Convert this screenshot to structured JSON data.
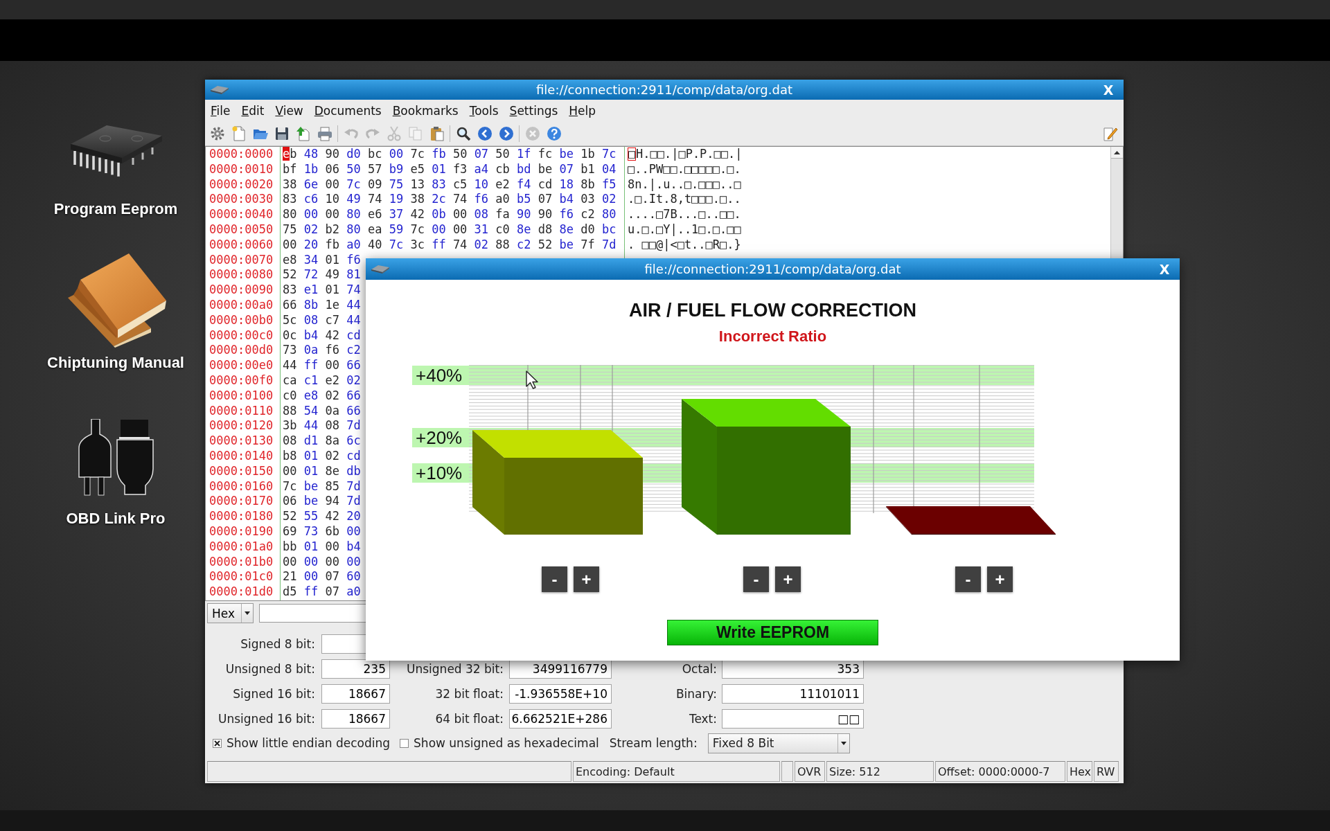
{
  "desktop_icons": [
    {
      "kind": "chip",
      "label": "Program Eeprom"
    },
    {
      "kind": "book",
      "label": "Chiptuning Manual"
    },
    {
      "kind": "plug",
      "label": "OBD Link Pro"
    }
  ],
  "editor_window": {
    "title": "file://connection:2911/comp/data/org.dat",
    "close": "X",
    "menu": [
      "File",
      "Edit",
      "View",
      "Documents",
      "Bookmarks",
      "Tools",
      "Settings",
      "Help"
    ],
    "toolbar_groups": [
      [
        {
          "kind": "settings",
          "disabled": false
        },
        {
          "kind": "new",
          "disabled": false
        },
        {
          "kind": "open",
          "disabled": false
        },
        {
          "kind": "save",
          "disabled": false
        },
        {
          "kind": "export",
          "disabled": false
        },
        {
          "kind": "print",
          "disabled": false
        }
      ],
      [
        {
          "kind": "undo",
          "disabled": true
        },
        {
          "kind": "redo",
          "disabled": true
        },
        {
          "kind": "cut",
          "disabled": true
        },
        {
          "kind": "copy",
          "disabled": true
        },
        {
          "kind": "paste",
          "disabled": false
        }
      ],
      [
        {
          "kind": "find",
          "disabled": false
        },
        {
          "kind": "back",
          "disabled": false
        },
        {
          "kind": "forward",
          "disabled": false
        }
      ],
      [
        {
          "kind": "stop",
          "disabled": true
        },
        {
          "kind": "help",
          "disabled": false
        }
      ]
    ],
    "toolbar_right": [
      {
        "kind": "edit",
        "disabled": false
      }
    ],
    "hex_view": {
      "rows": [
        {
          "address": "0000:0000",
          "bytes": [
            "eb",
            "48",
            "90",
            "d0",
            "bc",
            "00",
            "7c",
            "fb",
            "50",
            "07",
            "50",
            "1f",
            "fc",
            "be",
            "1b",
            "7c"
          ],
          "ascii": "□H.□□.|□P.P.□□.|",
          "cursor": true
        },
        {
          "address": "0000:0010",
          "bytes": [
            "bf",
            "1b",
            "06",
            "50",
            "57",
            "b9",
            "e5",
            "01",
            "f3",
            "a4",
            "cb",
            "bd",
            "be",
            "07",
            "b1",
            "04"
          ],
          "ascii": "□..PW□□.□□□□□.□.",
          "cursor": false
        },
        {
          "address": "0000:0020",
          "bytes": [
            "38",
            "6e",
            "00",
            "7c",
            "09",
            "75",
            "13",
            "83",
            "c5",
            "10",
            "e2",
            "f4",
            "cd",
            "18",
            "8b",
            "f5"
          ],
          "ascii": "8n.|.u..□.□□□..□",
          "cursor": false
        },
        {
          "address": "0000:0030",
          "bytes": [
            "83",
            "c6",
            "10",
            "49",
            "74",
            "19",
            "38",
            "2c",
            "74",
            "f6",
            "a0",
            "b5",
            "07",
            "b4",
            "03",
            "02"
          ],
          "ascii": ".□.It.8,t□□□.□..",
          "cursor": false
        },
        {
          "address": "0000:0040",
          "bytes": [
            "80",
            "00",
            "00",
            "80",
            "e6",
            "37",
            "42",
            "0b",
            "00",
            "08",
            "fa",
            "90",
            "90",
            "f6",
            "c2",
            "80"
          ],
          "ascii": "....□7B...□..□□.",
          "cursor": false
        },
        {
          "address": "0000:0050",
          "bytes": [
            "75",
            "02",
            "b2",
            "80",
            "ea",
            "59",
            "7c",
            "00",
            "00",
            "31",
            "c0",
            "8e",
            "d8",
            "8e",
            "d0",
            "bc"
          ],
          "ascii": "u.□.□Y|..1□.□.□□",
          "cursor": false
        },
        {
          "address": "0000:0060",
          "bytes": [
            "00",
            "20",
            "fb",
            "a0",
            "40",
            "7c",
            "3c",
            "ff",
            "74",
            "02",
            "88",
            "c2",
            "52",
            "be",
            "7f",
            "7d"
          ],
          "ascii": ". □□@|<□t..□R□.}",
          "cursor": false
        },
        {
          "address": "0000:0070",
          "bytes": [
            "e8",
            "34",
            "01",
            "f6"
          ],
          "cursor": false
        },
        {
          "address": "0000:0080",
          "bytes": [
            "52",
            "72",
            "49",
            "81"
          ],
          "cursor": false
        },
        {
          "address": "0000:0090",
          "bytes": [
            "83",
            "e1",
            "01",
            "74"
          ],
          "cursor": false
        },
        {
          "address": "0000:00a0",
          "bytes": [
            "66",
            "8b",
            "1e",
            "44"
          ],
          "cursor": false
        },
        {
          "address": "0000:00b0",
          "bytes": [
            "5c",
            "08",
            "c7",
            "44"
          ],
          "cursor": false
        },
        {
          "address": "0000:00c0",
          "bytes": [
            "0c",
            "b4",
            "42",
            "cd"
          ],
          "cursor": false
        },
        {
          "address": "0000:00d0",
          "bytes": [
            "73",
            "0a",
            "f6",
            "c2"
          ],
          "cursor": false
        },
        {
          "address": "0000:00e0",
          "bytes": [
            "44",
            "ff",
            "00",
            "66"
          ],
          "cursor": false
        },
        {
          "address": "0000:00f0",
          "bytes": [
            "ca",
            "c1",
            "e2",
            "02"
          ],
          "cursor": false
        },
        {
          "address": "0000:0100",
          "bytes": [
            "c0",
            "e8",
            "02",
            "66"
          ],
          "cursor": false
        },
        {
          "address": "0000:0110",
          "bytes": [
            "88",
            "54",
            "0a",
            "66"
          ],
          "cursor": false
        },
        {
          "address": "0000:0120",
          "bytes": [
            "3b",
            "44",
            "08",
            "7d"
          ],
          "cursor": false
        },
        {
          "address": "0000:0130",
          "bytes": [
            "08",
            "d1",
            "8a",
            "6c"
          ],
          "cursor": false
        },
        {
          "address": "0000:0140",
          "bytes": [
            "b8",
            "01",
            "02",
            "cd"
          ],
          "cursor": false
        },
        {
          "address": "0000:0150",
          "bytes": [
            "00",
            "01",
            "8e",
            "db"
          ],
          "cursor": false
        },
        {
          "address": "0000:0160",
          "bytes": [
            "7c",
            "be",
            "85",
            "7d"
          ],
          "cursor": false
        },
        {
          "address": "0000:0170",
          "bytes": [
            "06",
            "be",
            "94",
            "7d"
          ],
          "cursor": false
        },
        {
          "address": "0000:0180",
          "bytes": [
            "52",
            "55",
            "42",
            "20"
          ],
          "cursor": false
        },
        {
          "address": "0000:0190",
          "bytes": [
            "69",
            "73",
            "6b",
            "00"
          ],
          "cursor": false
        },
        {
          "address": "0000:01a0",
          "bytes": [
            "bb",
            "01",
            "00",
            "b4"
          ],
          "cursor": false
        },
        {
          "address": "0000:01b0",
          "bytes": [
            "00",
            "00",
            "00",
            "00"
          ],
          "cursor": false
        },
        {
          "address": "0000:01c0",
          "bytes": [
            "21",
            "00",
            "07",
            "60"
          ],
          "cursor": false
        },
        {
          "address": "0000:01d0",
          "bytes": [
            "d5",
            "ff",
            "07",
            "a0"
          ],
          "cursor": false
        }
      ]
    },
    "search_bar": {
      "mode": "Hex"
    },
    "decoding_columns": [
      [
        {
          "label": "Signed 8 bit:"
        },
        {
          "label": "Unsigned 8 bit:",
          "value": "235"
        },
        {
          "label": "Signed 16 bit:",
          "value": "18667"
        },
        {
          "label": "Unsigned 16 bit:",
          "value": "18667"
        }
      ],
      [
        {
          "label": "Unsigned 32 bit:",
          "value": "3499116779"
        },
        {
          "label": "32 bit float:",
          "value": "-1.936558E+10"
        },
        {
          "label": "64 bit float:",
          "value": "6.662521E+286"
        }
      ],
      [
        {
          "label": "Octal:",
          "value": "353"
        },
        {
          "label": "Binary:",
          "value": "11101011"
        },
        {
          "label": "Text:",
          "value": "□□"
        }
      ]
    ],
    "options": [
      {
        "label": "Show little endian decoding",
        "checked": true
      },
      {
        "label": "Show unsigned as hexadecimal",
        "checked": false
      }
    ],
    "stream_length": {
      "label": "Stream length:",
      "value": "Fixed 8 Bit"
    },
    "status_bar": [
      {
        "kind": "blank"
      },
      {
        "kind": "text",
        "text": "Encoding: Default"
      },
      {
        "kind": "blank"
      },
      {
        "kind": "text",
        "text": "OVR"
      },
      {
        "kind": "text",
        "text": "Size: 512"
      },
      {
        "kind": "text",
        "text": "Offset: 0000:0000-7"
      },
      {
        "kind": "text",
        "text": "Hex"
      },
      {
        "kind": "text",
        "text": "RW"
      }
    ]
  },
  "dialog": {
    "title": "file://connection:2911/comp/data/org.dat",
    "close": "X",
    "heading": "AIR / FUEL FLOW CORRECTION",
    "status": "Incorrect Ratio",
    "scale_labels": [
      "+40%",
      "+20%",
      "+10%"
    ],
    "bar_controls": [
      {
        "buttons": [
          "-",
          "+"
        ]
      },
      {
        "buttons": [
          "-",
          "+"
        ]
      },
      {
        "buttons": [
          "-",
          "+"
        ]
      }
    ],
    "write_button": "Write EEPROM"
  }
}
